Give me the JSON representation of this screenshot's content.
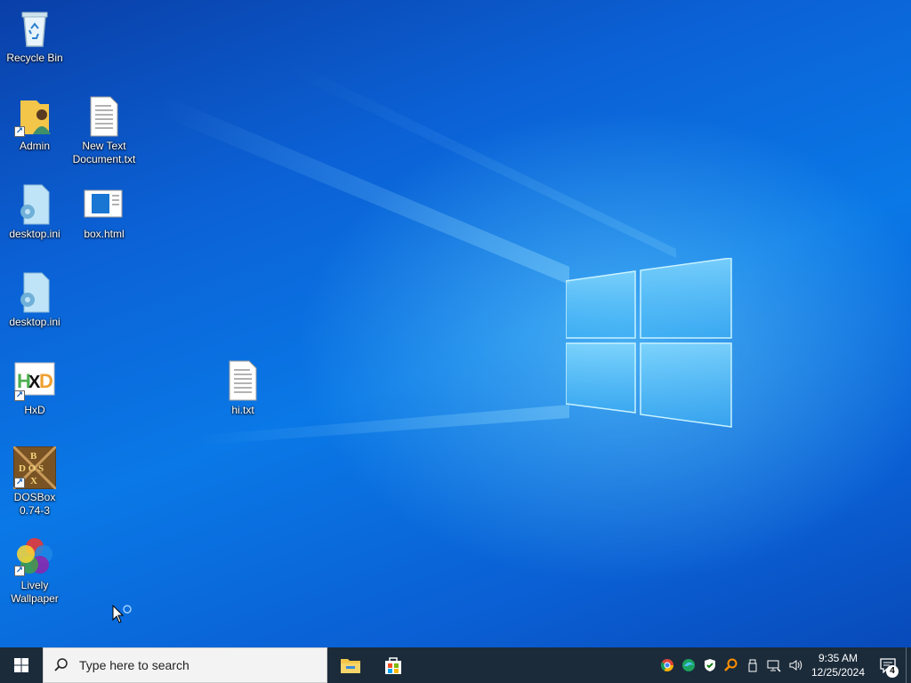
{
  "desktop": {
    "icons": {
      "recycle_bin": "Recycle Bin",
      "admin": "Admin",
      "new_text_document": "New Text Document.txt",
      "desktop_ini_1": "desktop.ini",
      "box_html": "box.html",
      "desktop_ini_2": "desktop.ini",
      "hxd": "HxD",
      "hi_txt": "hi.txt",
      "dosbox": "DOSBox 0.74-3",
      "lively_wallpaper": "Lively Wallpaper"
    }
  },
  "taskbar": {
    "search_placeholder": "Type here to search",
    "pinned_apps": [
      "file-explorer-icon",
      "microsoft-store-icon"
    ],
    "tray_icons": [
      "chrome-icon",
      "edge-icon",
      "defender-icon",
      "search-tool-icon",
      "usb-icon",
      "network-icon",
      "volume-icon"
    ],
    "clock": {
      "time": "9:35 AM",
      "date": "12/25/2024"
    },
    "notification_count": "4"
  },
  "colors": {
    "taskbar_bg": "#1b2b3a",
    "wallpaper_blue": "#0a78e6",
    "logo_light": "#7fd6ff"
  }
}
